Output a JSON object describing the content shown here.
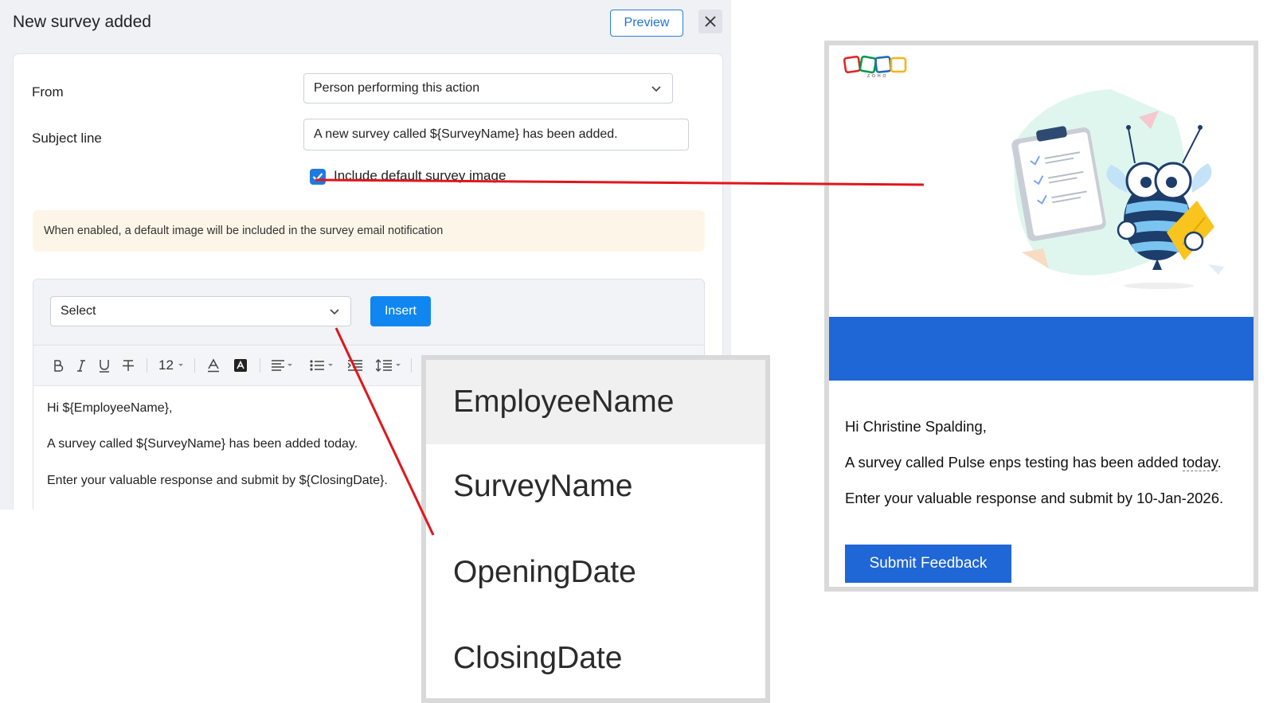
{
  "dialog": {
    "title": "New survey added",
    "preview_label": "Preview",
    "from_label": "From",
    "from_value": "Person performing this action",
    "subject_label": "Subject line",
    "subject_value": "A new survey called ${SurveyName} has been added.",
    "checkbox_label": "Include default survey image",
    "checkbox_checked": true,
    "info_text": "When enabled, a default image will be included in the survey email notification"
  },
  "editor": {
    "placeholder_select": "Select",
    "insert_label": "Insert",
    "font_size": "12",
    "lines": [
      "Hi ${EmployeeName},",
      "A survey called ${SurveyName} has been added today.",
      "Enter your valuable response and submit by ${ClosingDate}."
    ]
  },
  "dropdown": {
    "options": [
      "EmployeeName",
      "SurveyName",
      "OpeningDate",
      "ClosingDate"
    ],
    "highlighted": "EmployeeName"
  },
  "email_preview": {
    "logo_text": "ZOHO",
    "greeting": "Hi Christine Spalding,",
    "line1_prefix": "A survey called Pulse enps testing has been added ",
    "line1_today": "today",
    "line1_suffix": ".",
    "line2": "Enter your valuable response and submit by 10-Jan-2026.",
    "submit_label": "Submit Feedback",
    "colors": {
      "banner": "#1f66d6",
      "button": "#1f66d6"
    }
  },
  "colors": {
    "accent": "#1087f0",
    "callout": "#e0161c",
    "info_bg": "#fdf6e8"
  }
}
